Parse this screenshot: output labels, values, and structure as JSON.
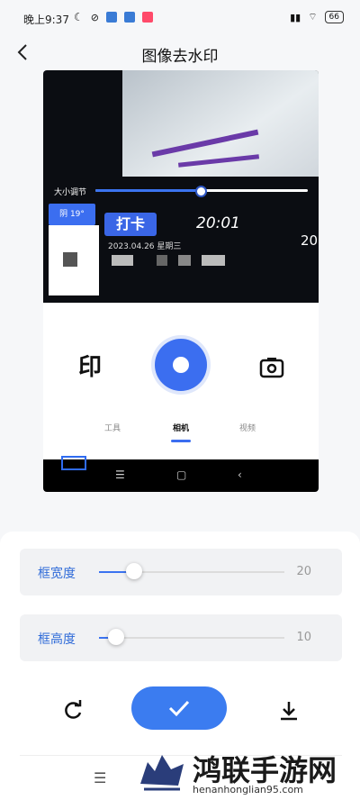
{
  "status": {
    "time": "晚上9:37",
    "battery": "66"
  },
  "header": {
    "title": "图像去水印"
  },
  "preview": {
    "size_slider": {
      "label": "大小调节",
      "value_fraction": 0.49
    },
    "weather_tag": "阴 19°",
    "punch_label": "打卡",
    "clock": "20:01",
    "date": "2023.04.26 星期三",
    "clock_right": "20",
    "yin_icon": "印",
    "mode_tabs": [
      {
        "label": "工具",
        "active": false
      },
      {
        "label": "相机",
        "active": true
      },
      {
        "label": "视频",
        "active": false
      }
    ],
    "nav": {
      "menu": "☰",
      "home": "▢",
      "back": "‹"
    }
  },
  "settings": {
    "frame_width": {
      "label": "框宽度",
      "value": "20",
      "fraction": 0.19
    },
    "frame_height": {
      "label": "框高度",
      "value": "10",
      "fraction": 0.09
    }
  },
  "bottom_menu": "☰",
  "watermark": {
    "name": "鸿联手游网",
    "url": "henanhonglian95.com"
  },
  "colors": {
    "accent": "#3b7cf0",
    "label": "#2f6bd8"
  }
}
